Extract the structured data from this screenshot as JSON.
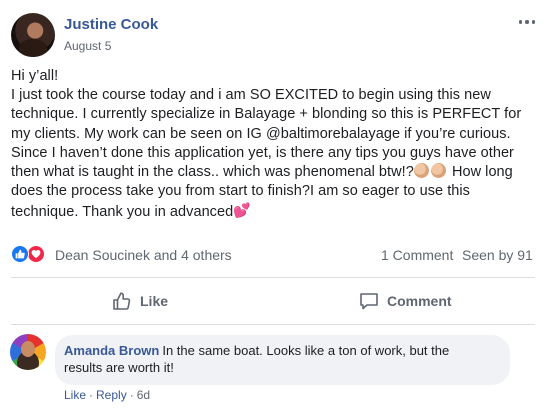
{
  "post": {
    "author": "Justine Cook",
    "date": "August 5",
    "lines": [
      "Hi y’all!",
      "I just took the course today and i am SO EXCITED to begin using this new",
      "technique. I currently specialize in Balayage + blonding so this is PERFECT for",
      "my clients. My work can be seen on IG @baltimorebalayage if you’re curious.",
      "Since I haven’t done this application yet, is there any tips you guys have other",
      "then what is taught in the class.. which was phenomenal btw!?",
      "How long",
      "does the process take you from start to finish?I am so eager to use this",
      "technique. Thank you in advanced"
    ],
    "emojis": [
      "clapping-hands",
      "clapping-hands",
      "two-hearts"
    ]
  },
  "reactions": {
    "names": "Dean Soucinek and 4 others",
    "comments": "1 Comment",
    "seen": "Seen by 91",
    "like_color": "#1877f2",
    "love_color": "#f0284a"
  },
  "actions": {
    "like_label": "Like",
    "comment_label": "Comment"
  },
  "comment": {
    "author": "Amanda Brown",
    "text_line1": "In the same boat. Looks like a ton of work, but the",
    "text_line2": "results are worth it!",
    "like": "Like",
    "reply": "Reply",
    "time": "6d"
  },
  "colors": {
    "link_blue": "#385898",
    "meta_gray": "#606770",
    "bubble_bg": "#f0f2f5"
  }
}
